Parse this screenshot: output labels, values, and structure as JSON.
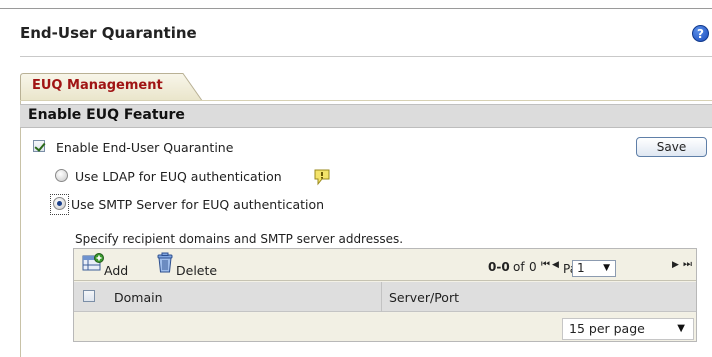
{
  "page": {
    "title": "End-User Quarantine",
    "help_icon": "help-icon"
  },
  "tabs": [
    {
      "label": "EUQ Management",
      "active": true
    }
  ],
  "section": {
    "title": "Enable EUQ Feature"
  },
  "options": {
    "enable_euq": {
      "label": "Enable End-User Quarantine",
      "checked": true
    },
    "ldap": {
      "label": "Use LDAP for EUQ authentication",
      "selected": false,
      "icon": "note-icon"
    },
    "smtp": {
      "label": "Use SMTP Server for EUQ authentication",
      "selected": true
    }
  },
  "save_button": {
    "label": "Save"
  },
  "servers": {
    "instruction": "Specify recipient domains and SMTP server addresses.",
    "toolbar": {
      "add_label": "Add",
      "delete_label": "Delete",
      "add_icon": "add-icon",
      "delete_icon": "trash-icon"
    },
    "pager": {
      "range": "0-0",
      "of_label": "of",
      "total": "0",
      "page_label": "Page",
      "current_page": "1"
    },
    "columns": [
      "Domain",
      "Server/Port"
    ],
    "rows": [],
    "per_page": "15 per page"
  },
  "colors": {
    "tab_label": "#a01414",
    "section_bg": "#dcdcdc",
    "toolbar_bg": "#f2f0e4",
    "header_bg": "#dedede"
  }
}
